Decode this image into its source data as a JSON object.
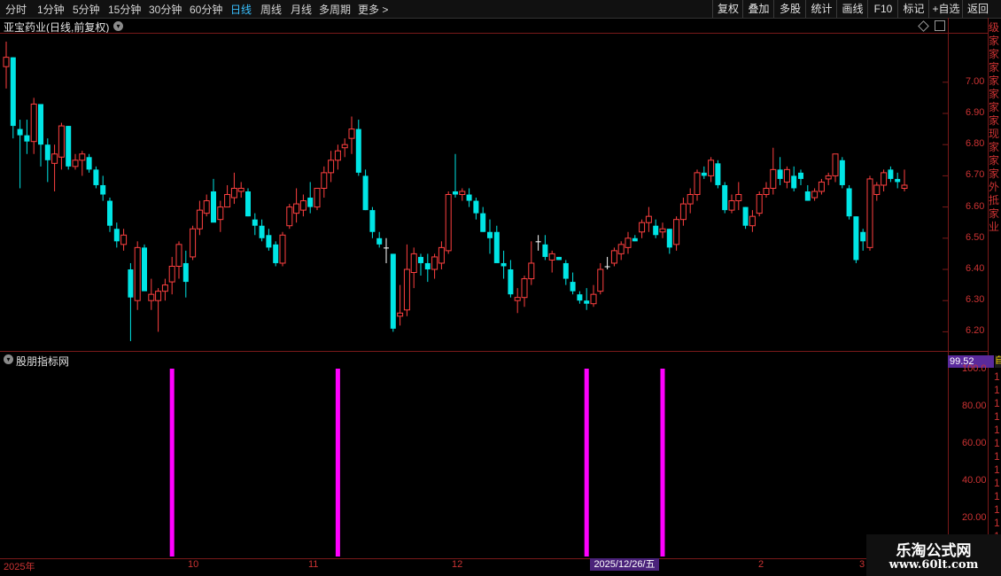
{
  "toolbar": {
    "periods": [
      "分时",
      "1分钟",
      "5分钟",
      "15分钟",
      "30分钟",
      "60分钟",
      "日线",
      "周线",
      "月线",
      "多周期",
      "更多 >"
    ],
    "active_period": "日线",
    "buttons": [
      "复权",
      "叠加",
      "多股",
      "统计",
      "画线",
      "F10",
      "标记",
      "+自选",
      "返回"
    ]
  },
  "stock": {
    "title": "亚宝药业(日线,前复权)"
  },
  "price_axis": {
    "labels": [
      "7.00",
      "6.90",
      "6.80",
      "6.70",
      "6.60",
      "6.50",
      "6.40",
      "6.30",
      "6.20"
    ],
    "values": [
      7.0,
      6.9,
      6.8,
      6.7,
      6.6,
      6.5,
      6.4,
      6.3,
      6.2
    ]
  },
  "indicator": {
    "title": "股朋指标网",
    "value": "99.52",
    "side_badge": "自",
    "axis_labels": [
      "100.0",
      "80.00",
      "60.00",
      "40.00",
      "20.00"
    ],
    "signal_bar_indices": [
      24,
      48,
      84,
      95
    ]
  },
  "dates": {
    "labels": [
      "2025年",
      "10",
      "11",
      "12",
      "2",
      "3"
    ],
    "cursor_label": "2025/12/26/五"
  },
  "side_panel_text": [
    "级",
    "家",
    "家",
    "家",
    "家",
    "家",
    "家",
    "家",
    "现",
    "家",
    "家",
    "家",
    "外",
    "抵",
    "家",
    "业"
  ],
  "side_panel_bottom": [
    "1",
    "1",
    "1",
    "1",
    "1",
    "1",
    "1",
    "1",
    "1",
    "1",
    "1",
    "1",
    "1",
    "1"
  ],
  "watermark": {
    "title": "乐淘公式网",
    "url": "www.60lt.com"
  },
  "colors": {
    "up": "#ff4040",
    "down": "#00e5e5",
    "signal": "#ff00ff",
    "doji": "#ffffff",
    "grid": "#7a1a1a"
  },
  "chart_data": {
    "type": "candlestick",
    "ohlc": [
      [
        7.05,
        7.13,
        6.98,
        7.08
      ],
      [
        7.08,
        7.08,
        6.82,
        6.86
      ],
      [
        6.85,
        6.88,
        6.66,
        6.83
      ],
      [
        6.83,
        6.88,
        6.77,
        6.81
      ],
      [
        6.81,
        6.95,
        6.77,
        6.93
      ],
      [
        6.93,
        6.93,
        6.73,
        6.8
      ],
      [
        6.8,
        6.82,
        6.68,
        6.75
      ],
      [
        6.74,
        6.8,
        6.65,
        6.77
      ],
      [
        6.76,
        6.87,
        6.72,
        6.86
      ],
      [
        6.86,
        6.86,
        6.72,
        6.73
      ],
      [
        6.73,
        6.77,
        6.72,
        6.75
      ],
      [
        6.75,
        6.78,
        6.7,
        6.77
      ],
      [
        6.76,
        6.77,
        6.71,
        6.72
      ],
      [
        6.72,
        6.73,
        6.66,
        6.67
      ],
      [
        6.67,
        6.7,
        6.62,
        6.64
      ],
      [
        6.62,
        6.63,
        6.52,
        6.54
      ],
      [
        6.53,
        6.55,
        6.47,
        6.49
      ],
      [
        6.48,
        6.53,
        6.46,
        6.51
      ],
      [
        6.4,
        6.42,
        6.17,
        6.31
      ],
      [
        6.3,
        6.49,
        6.27,
        6.47
      ],
      [
        6.47,
        6.48,
        6.34,
        6.33
      ],
      [
        6.3,
        6.37,
        6.27,
        6.32
      ],
      [
        6.3,
        6.34,
        6.2,
        6.33
      ],
      [
        6.33,
        6.37,
        6.3,
        6.35
      ],
      [
        6.36,
        6.44,
        6.32,
        6.41
      ],
      [
        6.41,
        6.49,
        6.37,
        6.48
      ],
      [
        6.42,
        6.46,
        6.31,
        6.36
      ],
      [
        6.44,
        6.54,
        6.43,
        6.53
      ],
      [
        6.53,
        6.62,
        6.51,
        6.59
      ],
      [
        6.58,
        6.64,
        6.57,
        6.62
      ],
      [
        6.65,
        6.69,
        6.56,
        6.55
      ],
      [
        6.56,
        6.62,
        6.52,
        6.6
      ],
      [
        6.6,
        6.67,
        6.6,
        6.64
      ],
      [
        6.63,
        6.71,
        6.61,
        6.66
      ],
      [
        6.65,
        6.68,
        6.63,
        6.66
      ],
      [
        6.65,
        6.66,
        6.57,
        6.57
      ],
      [
        6.56,
        6.58,
        6.51,
        6.54
      ],
      [
        6.54,
        6.56,
        6.49,
        6.5
      ],
      [
        6.51,
        6.53,
        6.46,
        6.47
      ],
      [
        6.48,
        6.49,
        6.41,
        6.42
      ],
      [
        6.42,
        6.52,
        6.41,
        6.51
      ],
      [
        6.54,
        6.61,
        6.53,
        6.6
      ],
      [
        6.58,
        6.66,
        6.55,
        6.61
      ],
      [
        6.59,
        6.64,
        6.57,
        6.62
      ],
      [
        6.63,
        6.68,
        6.58,
        6.6
      ],
      [
        6.6,
        6.66,
        6.59,
        6.66
      ],
      [
        6.66,
        6.73,
        6.63,
        6.71
      ],
      [
        6.71,
        6.78,
        6.68,
        6.75
      ],
      [
        6.75,
        6.8,
        6.72,
        6.78
      ],
      [
        6.79,
        6.82,
        6.76,
        6.8
      ],
      [
        6.82,
        6.89,
        6.77,
        6.85
      ],
      [
        6.85,
        6.88,
        6.7,
        6.71
      ],
      [
        6.7,
        6.72,
        6.59,
        6.59
      ],
      [
        6.59,
        6.6,
        6.5,
        6.52
      ],
      [
        6.5,
        6.52,
        6.47,
        6.48
      ],
      [
        6.47,
        6.5,
        6.42,
        6.47
      ],
      [
        6.45,
        6.45,
        6.2,
        6.21
      ],
      [
        6.25,
        6.35,
        6.22,
        6.26
      ],
      [
        6.27,
        6.48,
        6.25,
        6.4
      ],
      [
        6.39,
        6.47,
        6.34,
        6.45
      ],
      [
        6.44,
        6.45,
        6.38,
        6.42
      ],
      [
        6.42,
        6.45,
        6.36,
        6.4
      ],
      [
        6.4,
        6.45,
        6.37,
        6.44
      ],
      [
        6.42,
        6.49,
        6.4,
        6.47
      ],
      [
        6.46,
        6.65,
        6.45,
        6.64
      ],
      [
        6.65,
        6.77,
        6.63,
        6.64
      ],
      [
        6.64,
        6.66,
        6.62,
        6.65
      ],
      [
        6.64,
        6.66,
        6.6,
        6.62
      ],
      [
        6.62,
        6.63,
        6.56,
        6.58
      ],
      [
        6.58,
        6.6,
        6.52,
        6.52
      ],
      [
        6.52,
        6.56,
        6.45,
        6.5
      ],
      [
        6.52,
        6.54,
        6.44,
        6.42
      ],
      [
        6.42,
        6.46,
        6.37,
        6.41
      ],
      [
        6.4,
        6.43,
        6.31,
        6.32
      ],
      [
        6.3,
        6.34,
        6.26,
        6.31
      ],
      [
        6.31,
        6.38,
        6.28,
        6.37
      ],
      [
        6.37,
        6.49,
        6.35,
        6.42
      ],
      [
        6.49,
        6.51,
        6.46,
        6.49
      ],
      [
        6.48,
        6.51,
        6.43,
        6.44
      ],
      [
        6.43,
        6.46,
        6.39,
        6.45
      ],
      [
        6.44,
        6.44,
        6.43,
        6.43
      ],
      [
        6.42,
        6.43,
        6.35,
        6.37
      ],
      [
        6.36,
        6.39,
        6.32,
        6.33
      ],
      [
        6.32,
        6.33,
        6.29,
        6.3
      ],
      [
        6.3,
        6.34,
        6.27,
        6.29
      ],
      [
        6.29,
        6.35,
        6.28,
        6.32
      ],
      [
        6.33,
        6.42,
        6.32,
        6.4
      ],
      [
        6.41,
        6.44,
        6.4,
        6.41
      ],
      [
        6.42,
        6.47,
        6.41,
        6.46
      ],
      [
        6.45,
        6.49,
        6.43,
        6.48
      ],
      [
        6.47,
        6.52,
        6.45,
        6.5
      ],
      [
        6.5,
        6.51,
        6.49,
        6.49
      ],
      [
        6.52,
        6.56,
        6.5,
        6.55
      ],
      [
        6.55,
        6.6,
        6.52,
        6.57
      ],
      [
        6.54,
        6.56,
        6.5,
        6.51
      ],
      [
        6.52,
        6.55,
        6.5,
        6.53
      ],
      [
        6.53,
        6.53,
        6.45,
        6.47
      ],
      [
        6.48,
        6.57,
        6.46,
        6.56
      ],
      [
        6.56,
        6.63,
        6.54,
        6.61
      ],
      [
        6.61,
        6.66,
        6.58,
        6.64
      ],
      [
        6.64,
        6.72,
        6.62,
        6.71
      ],
      [
        6.71,
        6.73,
        6.69,
        6.7
      ],
      [
        6.7,
        6.76,
        6.68,
        6.75
      ],
      [
        6.74,
        6.75,
        6.66,
        6.67
      ],
      [
        6.67,
        6.68,
        6.58,
        6.59
      ],
      [
        6.59,
        6.64,
        6.58,
        6.62
      ],
      [
        6.62,
        6.68,
        6.59,
        6.64
      ],
      [
        6.6,
        6.6,
        6.53,
        6.54
      ],
      [
        6.54,
        6.59,
        6.52,
        6.57
      ],
      [
        6.58,
        6.65,
        6.57,
        6.64
      ],
      [
        6.64,
        6.68,
        6.63,
        6.66
      ],
      [
        6.66,
        6.79,
        6.64,
        6.72
      ],
      [
        6.72,
        6.76,
        6.67,
        6.69
      ],
      [
        6.68,
        6.73,
        6.66,
        6.72
      ],
      [
        6.7,
        6.73,
        6.65,
        6.66
      ],
      [
        6.71,
        6.72,
        6.67,
        6.69
      ],
      [
        6.65,
        6.67,
        6.62,
        6.62
      ],
      [
        6.63,
        6.66,
        6.62,
        6.65
      ],
      [
        6.65,
        6.69,
        6.64,
        6.68
      ],
      [
        6.69,
        6.71,
        6.67,
        6.7
      ],
      [
        6.7,
        6.77,
        6.68,
        6.77
      ],
      [
        6.75,
        6.76,
        6.66,
        6.67
      ],
      [
        6.66,
        6.67,
        6.56,
        6.57
      ],
      [
        6.57,
        6.57,
        6.42,
        6.43
      ],
      [
        6.52,
        6.53,
        6.46,
        6.49
      ],
      [
        6.47,
        6.7,
        6.46,
        6.69
      ],
      [
        6.64,
        6.68,
        6.62,
        6.67
      ],
      [
        6.67,
        6.72,
        6.65,
        6.71
      ],
      [
        6.72,
        6.73,
        6.68,
        6.69
      ],
      [
        6.69,
        6.71,
        6.66,
        6.68
      ],
      [
        6.66,
        6.72,
        6.65,
        6.67
      ]
    ],
    "ylim": [
      6.15,
      7.15
    ],
    "indicator_ylim": [
      0,
      100
    ]
  }
}
